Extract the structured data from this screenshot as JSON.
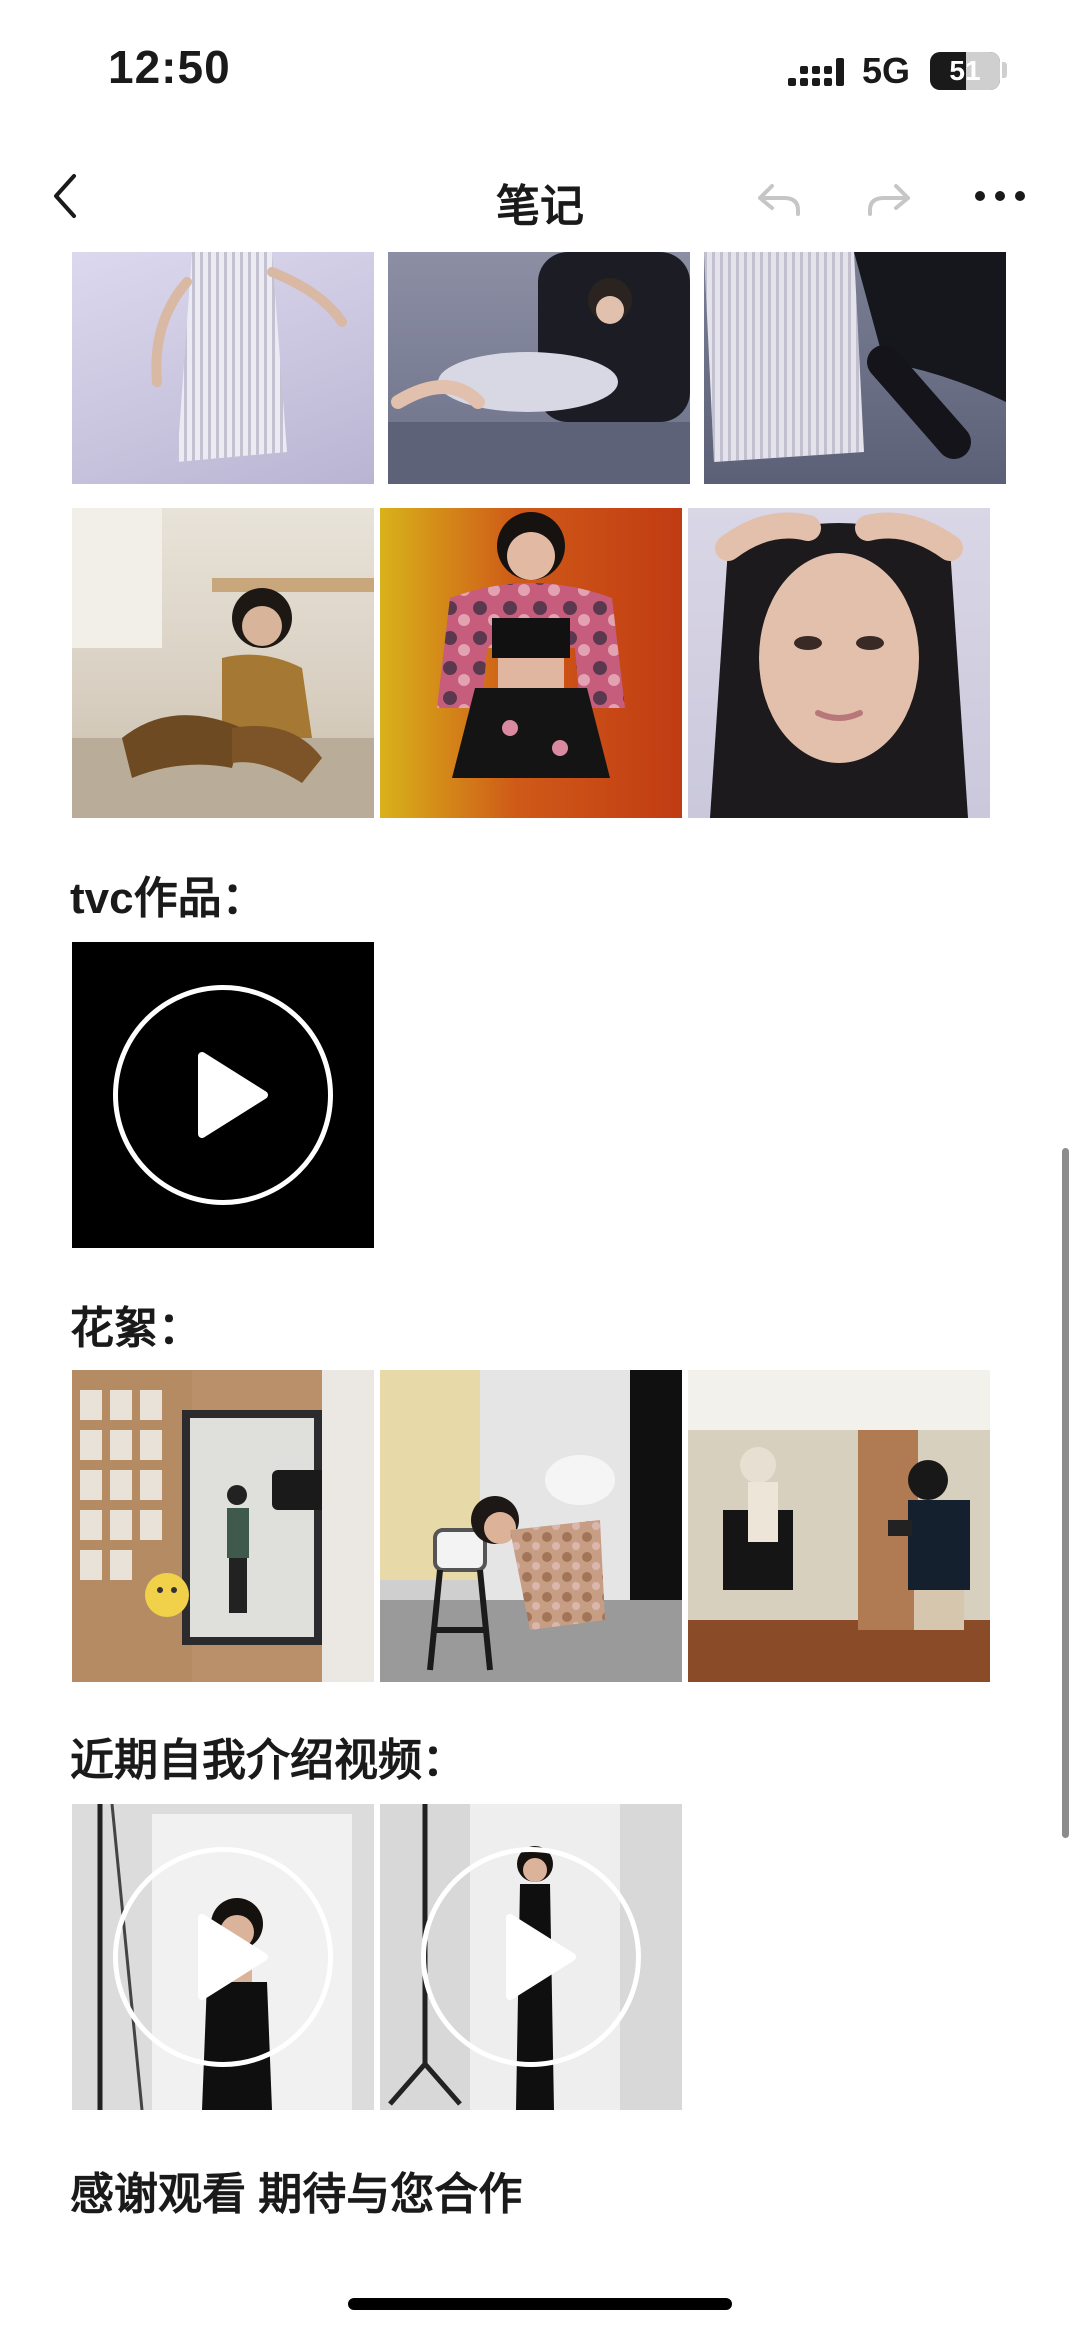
{
  "status_bar": {
    "time": "12:50",
    "network": "5G",
    "battery": "51",
    "icons": [
      "signal-icon",
      "battery-icon"
    ]
  },
  "nav": {
    "title": "笔记",
    "icons": [
      "back-icon",
      "undo-icon",
      "redo-icon",
      "more-icon"
    ]
  },
  "sections": {
    "tvc_title": "tvc作品：",
    "behind_scenes_title": "花絮：",
    "intro_title": "近期自我介绍视频：",
    "closing": "感谢观看 期待与您合作"
  },
  "colors": {
    "accent_text": "#1a1a1a",
    "background": "#ffffff",
    "video_background": "#000000"
  }
}
